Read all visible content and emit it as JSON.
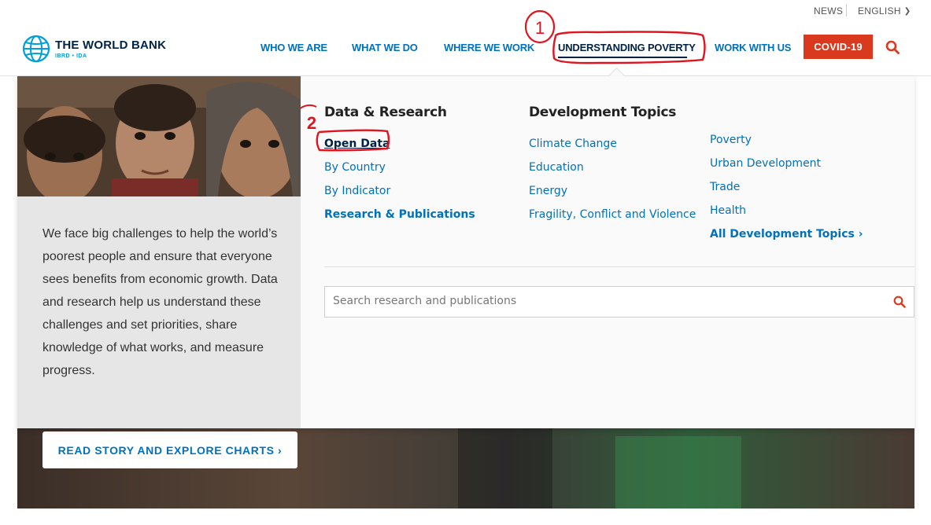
{
  "topbar": {
    "news": "NEWS",
    "language": "ENGLISH"
  },
  "logo": {
    "title": "THE WORLD BANK",
    "subtitle": "IBRD • IDA"
  },
  "nav": {
    "items": [
      {
        "label": "WHO WE ARE"
      },
      {
        "label": "WHAT WE DO"
      },
      {
        "label": "WHERE WE WORK"
      },
      {
        "label": "UNDERSTANDING POVERTY",
        "active": true
      },
      {
        "label": "WORK WITH US"
      }
    ],
    "covid": "COVID-19"
  },
  "mega": {
    "intro": "We face big challenges to help the world’s poorest people and ensure that everyone sees benefits from economic growth. Data and research help us understand these challenges and set priorities, share knowledge of what works, and measure progress.",
    "data_research": {
      "title": "Data & Research",
      "links": [
        "Open Data",
        "By Country",
        "By Indicator",
        "Research & Publications"
      ]
    },
    "dev_topics": {
      "title": "Development Topics",
      "col1": [
        "Climate Change",
        "Education",
        "Energy",
        "Fragility, Conflict and Violence"
      ],
      "col2": [
        "Poverty",
        "Urban Development",
        "Trade",
        "Health"
      ],
      "all": "All Development Topics ›"
    },
    "search": {
      "placeholder": "Search research and publications"
    }
  },
  "hero": {
    "cta": "READ STORY AND EXPLORE CHARTS ›"
  },
  "annotations": {
    "step1": "1",
    "step2": "2",
    "color": "#e0141e"
  },
  "icons": {
    "chevron": "chevron-down-icon",
    "search": "search-icon",
    "globe": "globe-icon"
  }
}
